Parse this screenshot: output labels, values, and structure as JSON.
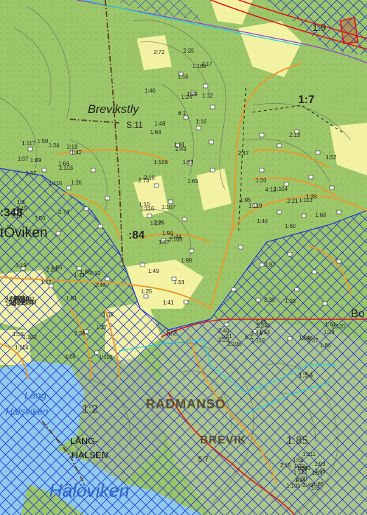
{
  "place_names": {
    "brevikstly": "Brevikstly",
    "radmanso": "RADMANSÖ",
    "brevik": "BREVIK",
    "lang_halsen_line1": "LÅNG-",
    "lang_halsen_line2": "HALSEN",
    "stoviken": "tÖviken",
    "bo_fragment": "Bo"
  },
  "water_names": {
    "halsviken_line1": "Lång-",
    "halsviken_line2": "Halsviken",
    "haloviken": "Hälöviken"
  },
  "property_codes": {
    "s11": "S:11",
    "code_348": ":348",
    "code_84": ":84",
    "code_12_large": "1:2",
    "code_185": "1:85",
    "code_17_top": "1:7",
    "code_19_top": "1:9",
    "code_57": "5:7",
    "code_52": "5:2",
    "code_54": "1:54"
  },
  "parcels": [
    "6:1",
    "1:116",
    "1:115",
    "1:114",
    "1:113",
    "1:112",
    "1:111",
    "1:110",
    "1:109",
    "1:108",
    "1:117",
    "1:118",
    "1:119",
    "1:120",
    "1:121",
    "1:122",
    "1:106",
    "1:107",
    "1:103",
    "1:102",
    "1:104",
    "1:105",
    "1:101",
    "1:100",
    "1:99",
    "1:98",
    "1:97",
    "1:96",
    "1:95",
    "1:94",
    "1:93",
    "1:92",
    "1:91",
    "1:90",
    "1:89",
    "1:88",
    "1:87",
    "1:86",
    "1:85",
    "2:34",
    "2:35",
    "2:36",
    "2:37",
    "2:38",
    "2:39",
    "2:40",
    "2:41",
    "2:42",
    "2:43",
    "2:44",
    "2:45",
    "2:46",
    "2:47",
    "2:48",
    "2:49",
    "2:50",
    "2:72",
    "2:73",
    "2:74",
    "2:12",
    "2:13",
    "2:14",
    "2:15",
    "2:16",
    "2:17",
    "2:18",
    "2:19",
    "2:20",
    "2:21",
    "2:22",
    "1:14",
    "1:15",
    "1:16",
    "1:17",
    "1:18",
    "1:19",
    "1:20",
    "1:21",
    "1:22",
    "1:23",
    "1:24",
    "1:25",
    "1:26",
    "1:27",
    "1:28",
    "1:29",
    "1:30",
    "1:31",
    "1:32",
    "1:33",
    "1:34",
    "1:35",
    "1:36",
    "1:37",
    "1:38",
    "1:39",
    "1:40",
    "1:41",
    "1:42",
    "1:43",
    "1:44",
    "1:45",
    "1:46",
    "1:47",
    "1:48",
    "1:49",
    "1:50",
    "1:51",
    "1:52",
    "1:53",
    "1:54",
    "1:55",
    "1:56",
    "1:57",
    "1:58",
    "1:59",
    "1:60",
    "1:61",
    "1:62",
    "1:63",
    "1:64",
    "1:65",
    "1:66",
    "1:67",
    "1:68",
    "5:1",
    "5:6",
    "6",
    "1:12",
    "1:10",
    "1:8",
    "4:16",
    "4:12",
    "2:346"
  ],
  "colors": {
    "forest": "#9cc66a",
    "open_land": "#f3f2a3",
    "water": "#8ec9ee",
    "hatch_blue": "#1c2ed8",
    "boundary_red": "#e01010",
    "road_orange": "#e89a2c",
    "contour_gray": "#5d6b55",
    "cyan_line": "#22d0e0",
    "purple_line": "#8a3ad8"
  }
}
